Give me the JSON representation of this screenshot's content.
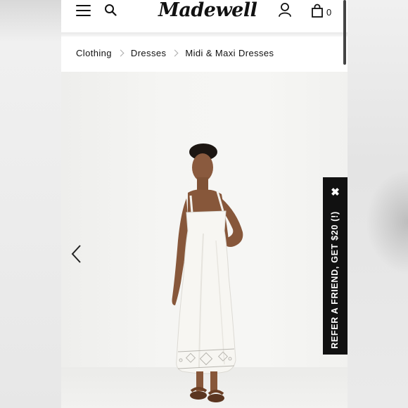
{
  "header": {
    "logo_text": "Madewell",
    "cart_count": "0",
    "icons": {
      "menu": "hamburger-menu-icon",
      "search": "search-icon",
      "account": "user-icon",
      "cart": "shopping-bag-icon"
    }
  },
  "breadcrumb": {
    "items": [
      "Clothing",
      "Dresses",
      "Midi & Maxi Dresses"
    ]
  },
  "gallery": {
    "prev_icon": "chevron-left-icon"
  },
  "promo": {
    "refer_text": "REFER A FRIEND, GET $20 (!)",
    "close_label": "✖"
  },
  "colors": {
    "background": "#ffffff",
    "text": "#111111",
    "promo_bg": "#111111",
    "promo_text": "#ffffff"
  }
}
